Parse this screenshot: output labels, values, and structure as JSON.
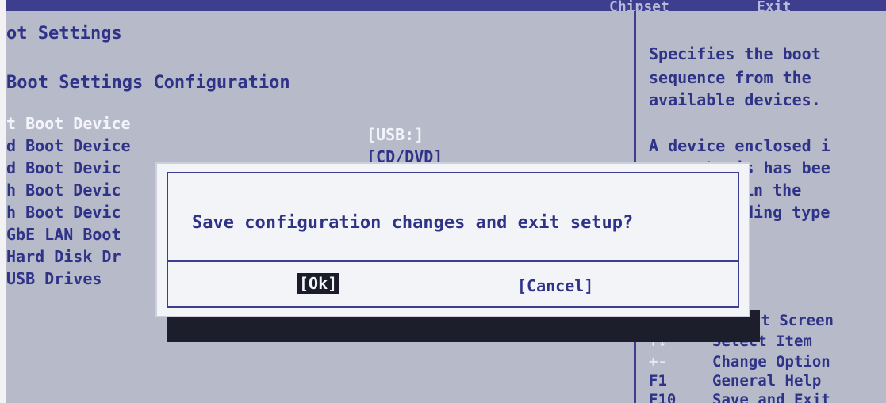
{
  "top_menu": {
    "items": [
      "Chipset",
      "Exit"
    ]
  },
  "panel": {
    "title": "ot Settings",
    "section_title": "Boot Settings Configuration",
    "boot_items": [
      "t Boot Device",
      "d Boot Device",
      "d Boot Devic",
      "h Boot Devic",
      "h Boot Devic",
      "GbE LAN Boot",
      "Hard Disk Dr",
      "USB Drives"
    ],
    "boot_values": [
      "[USB:]",
      "[CD/DVD]"
    ]
  },
  "help": {
    "lines": [
      "Specifies the boot",
      "sequence from the",
      "available devices.",
      "A device enclosed i",
      "parenthesis has bee",
      " in the",
      "ding type"
    ]
  },
  "keys": {
    "rows": [
      {
        "key": "",
        "desc": "ct Screen"
      },
      {
        "key": "↑↓",
        "desc": "Select Item"
      },
      {
        "key": "+-",
        "desc": "Change Option"
      },
      {
        "key": "F1",
        "desc": "General Help"
      },
      {
        "key": "F10",
        "desc": "Save and Exit"
      }
    ]
  },
  "dialog": {
    "message": "Save configuration changes and exit setup?",
    "ok_label": "[Ok]",
    "cancel_label": "[Cancel]"
  },
  "colors": {
    "background": "#b7bac9",
    "bios_blue": "#2f3387",
    "dialog_bg": "#f3f4f8",
    "selected": "#1a1c2a"
  }
}
